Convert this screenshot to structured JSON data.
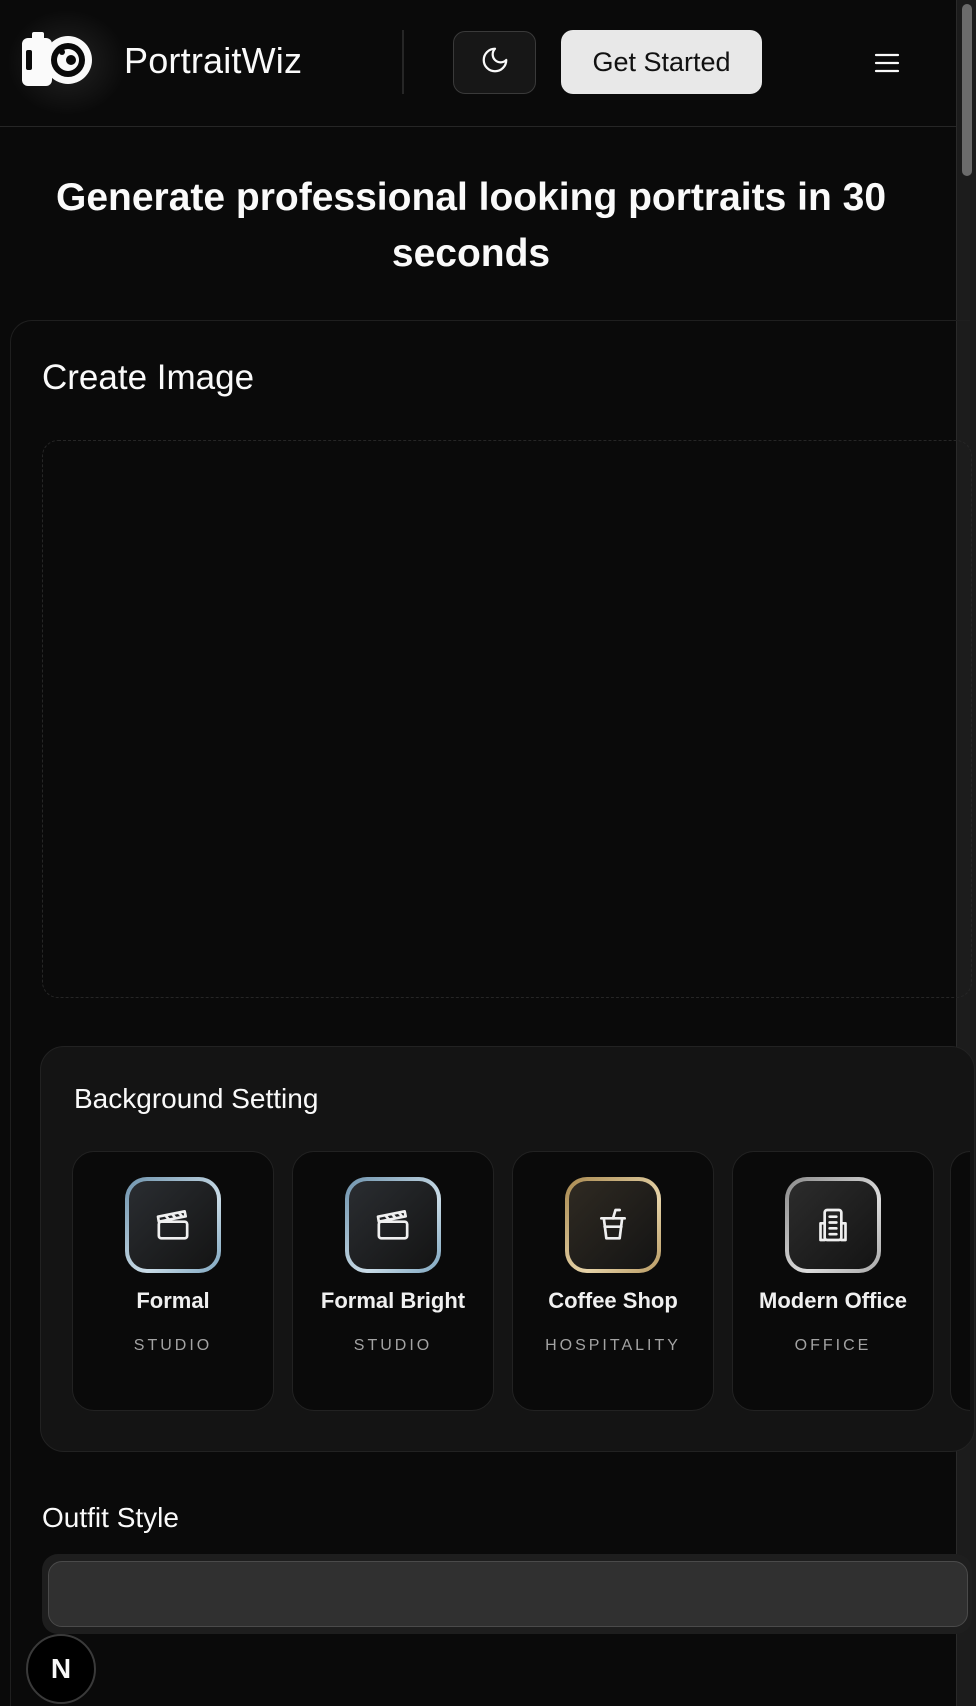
{
  "header": {
    "brand": "PortraitWiz",
    "logo_icon": "camera-icon",
    "theme_icon": "moon-icon",
    "cta_label": "Get Started",
    "menu_icon": "hamburger-menu-icon"
  },
  "hero": {
    "title": "Generate professional looking portraits in 30 seconds"
  },
  "create": {
    "title": "Create Image"
  },
  "background_setting": {
    "title": "Background Setting",
    "options": [
      {
        "name": "Formal",
        "category": "STUDIO",
        "icon": "clapperboard-icon",
        "accent": "#7ea6c0"
      },
      {
        "name": "Formal Bright",
        "category": "STUDIO",
        "icon": "clapperboard-icon",
        "accent": "#7ea6c0"
      },
      {
        "name": "Coffee Shop",
        "category": "HOSPITALITY",
        "icon": "cup-icon",
        "accent": "#b89a63"
      },
      {
        "name": "Modern Office",
        "category": "OFFICE",
        "icon": "building-icon",
        "accent": "#a8a8a8"
      }
    ]
  },
  "outfit": {
    "label": "Outfit Style",
    "value": ""
  },
  "badge": {
    "letter": "N"
  }
}
